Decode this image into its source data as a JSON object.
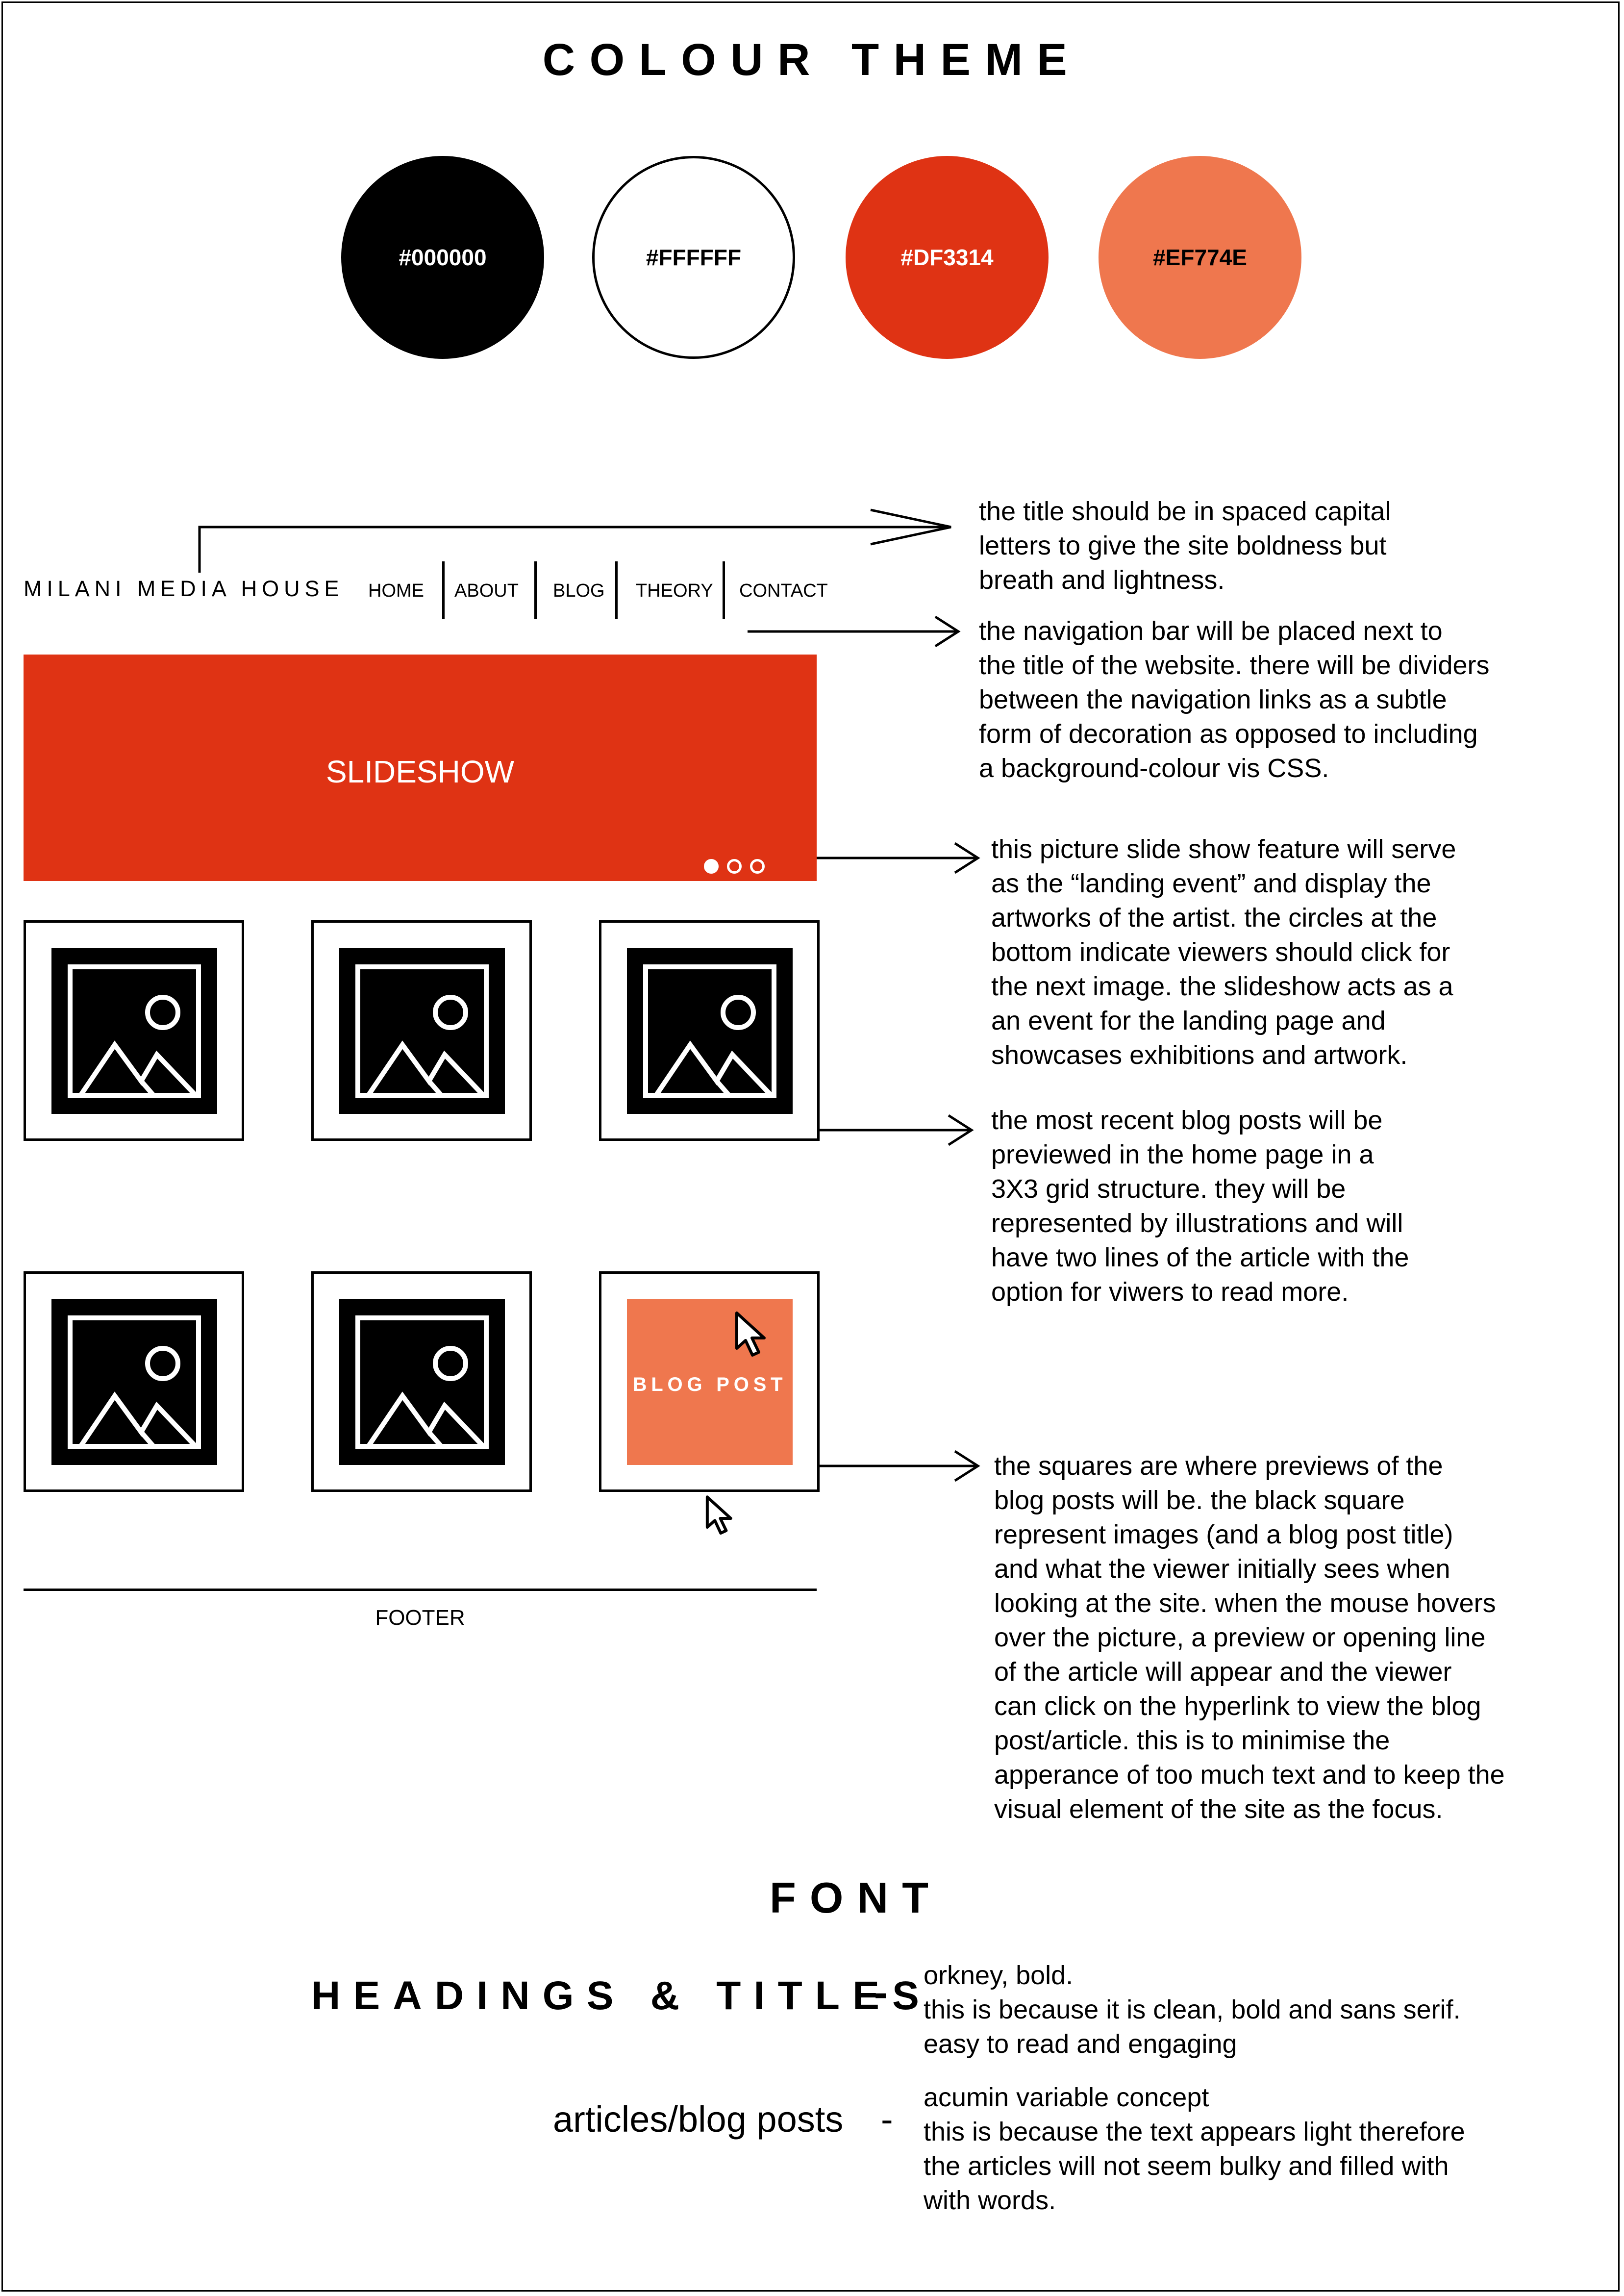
{
  "colour_theme": {
    "heading": "COLOUR THEME",
    "swatches": [
      {
        "label": "#000000",
        "color": "#000000",
        "text_color": "#FFFFFF"
      },
      {
        "label": "#FFFFFF",
        "color": "#FFFFFF",
        "text_color": "#000000"
      },
      {
        "label": "#DF3314",
        "color": "#DF3314",
        "text_color": "#FFFFFF"
      },
      {
        "label": "#EF774E",
        "color": "#EF774E",
        "text_color": "#000000"
      }
    ]
  },
  "wireframe": {
    "site_title": "MILANI MEDIA HOUSE",
    "nav": [
      "HOME",
      "ABOUT",
      "BLOG",
      "THEORY",
      "CONTACT"
    ],
    "slideshow_label": "SLIDESHOW",
    "slide_dots": 3,
    "blog_post_label": "BLOG POST",
    "footer_label": "FOOTER"
  },
  "annotations": {
    "title": "the title should be in spaced capital\nletters to give the site boldness but\nbreath and lightness.",
    "navigation": "the navigation bar will be placed next to\nthe title of the website. there will be dividers\nbetween the navigation links as a subtle\nform of decoration as opposed to including\na background-colour vis CSS.",
    "slideshow": "this picture slide show feature will serve\nas the “landing event” and display the\nartworks of the artist. the circles at the\nbottom indicate viewers should click for\nthe next image. the slideshow acts as a\nan event for the landing page and\nshowcases exhibitions and artwork.",
    "grid": "the most recent blog posts will be\npreviewed in the home page in a\n3X3 grid structure. they will be\nrepresented by illustrations and will\nhave two lines of the article with the\noption for viwers to read more.",
    "squares": "the squares are where previews of the\nblog posts will be. the black square\nrepresent images (and a blog post title)\nand what the viewer initially sees when\nlooking at the site. when the mouse hovers\nover the picture, a preview or opening line\nof the article will appear and the viewer\ncan click on the hyperlink to view the blog\npost/article. this is to minimise the\napperance of too much text and to keep the\nvisual element of the site as the focus."
  },
  "font": {
    "heading": "FONT",
    "headings_label": "HEADINGS & TITLES",
    "headings_dash": "-",
    "headings_desc": "orkney, bold.\nthis is because it is clean, bold and sans serif.\neasy to read and engaging",
    "articles_label": "articles/blog posts",
    "articles_dash": "-",
    "articles_desc": "acumin variable concept\nthis is because the text appears light therefore\nthe articles will not seem bulky and filled with\nwith words."
  }
}
